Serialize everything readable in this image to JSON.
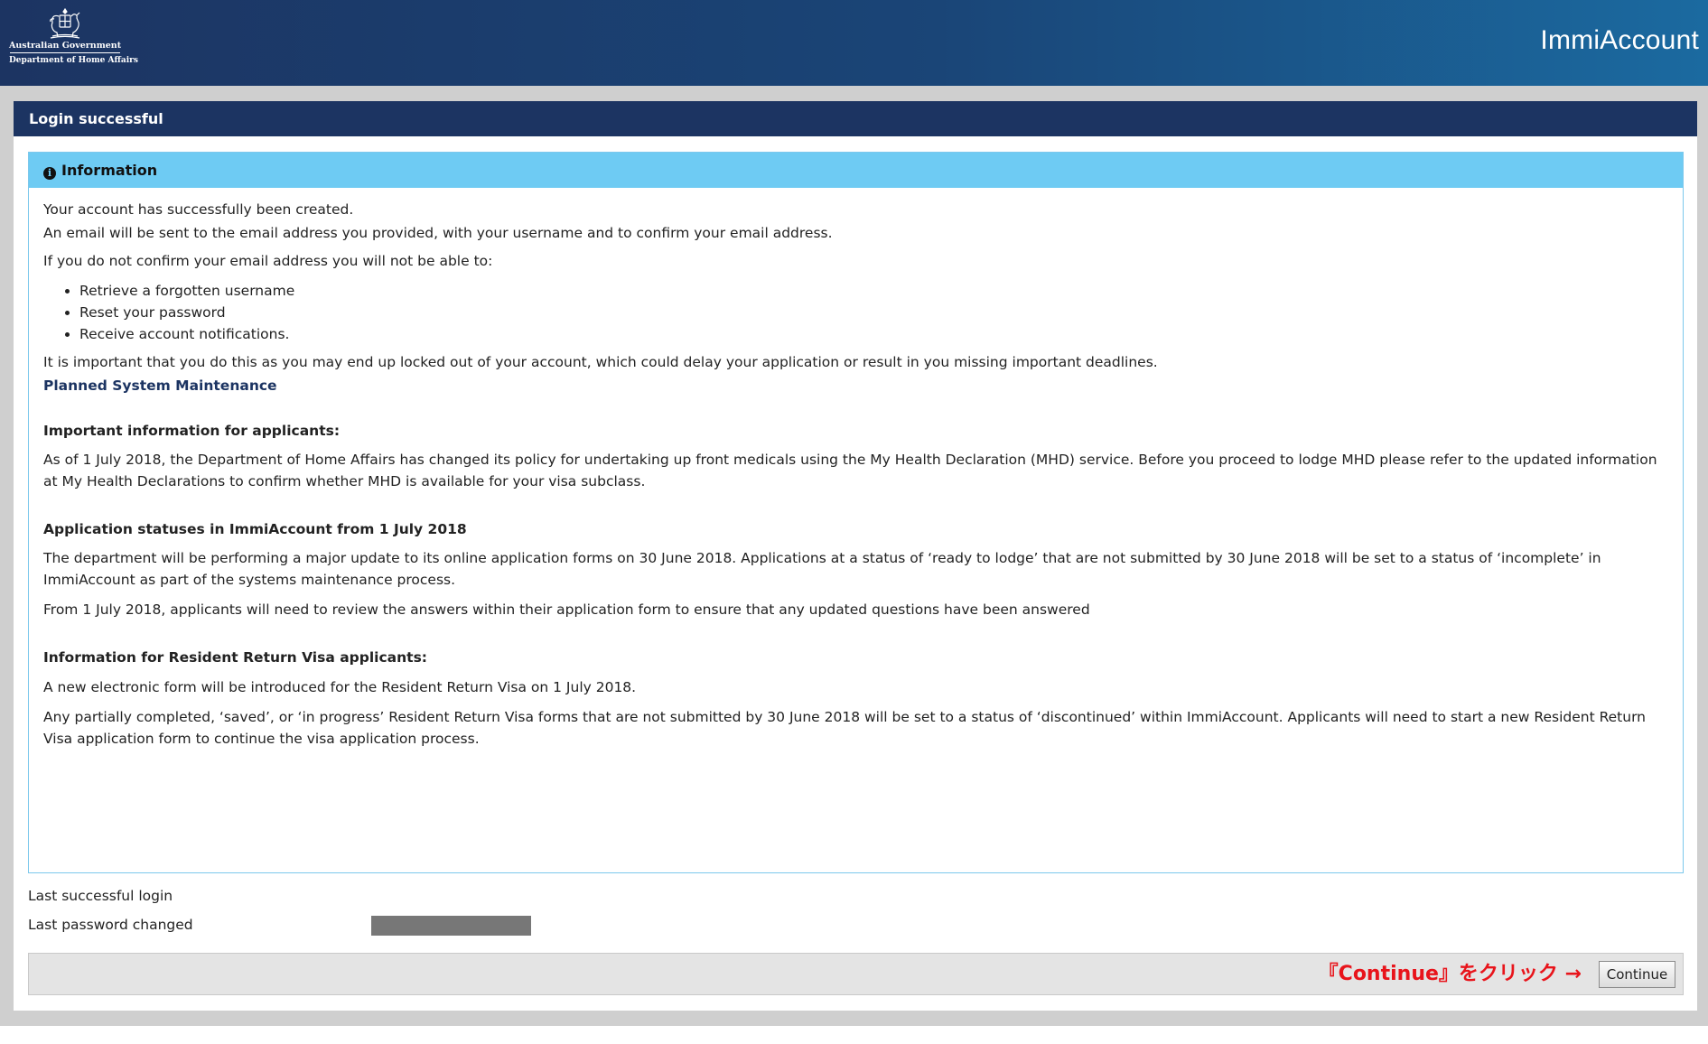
{
  "header": {
    "gov_name": "Australian Government",
    "dept_name": "Department of Home Affairs",
    "app_name": "ImmiAccount",
    "logo_icon": "coat-of-arms-icon"
  },
  "panel": {
    "title": "Login successful"
  },
  "info": {
    "icon": "info-icon",
    "icon_glyph": "i",
    "title": "Information",
    "p1": "Your account has successfully been created.",
    "p2": "An email will be sent to the email address you provided, with your username and to confirm your email address.",
    "p3": "If you do not confirm your email address you will not be able to:",
    "bullets": [
      "Retrieve a forgotten username",
      "Reset your password",
      "Receive account notifications."
    ],
    "p4": "It is important that you do this as you may end up locked out of your account, which could delay your application or result in you missing important deadlines.",
    "maintenance_link": "Planned System Maintenance",
    "applicants_heading": "Important information for applicants:",
    "applicants_text": "As of 1 July 2018, the Department of Home Affairs has changed its policy for undertaking up front medicals using the My Health Declaration (MHD) service. Before you proceed to lodge MHD please refer to the updated information at My Health Declarations to confirm whether MHD is available for your visa subclass.",
    "statuses_heading": "Application statuses in ImmiAccount from 1 July 2018",
    "statuses_text1": "The department will be performing a major update to its online application forms on 30 June 2018.  Applications at a status of ‘ready to lodge’ that are not submitted by 30 June 2018  will be set to a status of ‘incomplete’ in ImmiAccount as part of the systems maintenance process.",
    "statuses_text2": "From 1 July 2018, applicants will need to review the answers within their application form to ensure that any updated questions have been answered",
    "rrv_heading": "Information for Resident Return Visa applicants:",
    "rrv_text1": "A new electronic form will be introduced for the Resident Return Visa on 1 July 2018.",
    "rrv_text2": "Any partially completed, ‘saved’, or ‘in progress’ Resident Return Visa forms that are not submitted by 30 June 2018 will be set to a status of ‘discontinued’ within ImmiAccount. Applicants will need to start a new Resident Return Visa application form to continue the visa application process."
  },
  "login": {
    "last_login_label": "Last successful login",
    "last_password_label": "Last password changed"
  },
  "actions": {
    "hint": "『Continue』をクリック →",
    "continue_label": "Continue"
  },
  "colors": {
    "header_dark": "#1c3462",
    "header_light": "#1b6aa0",
    "info_header": "#6ecbf3",
    "hint_red": "#e8141b"
  }
}
